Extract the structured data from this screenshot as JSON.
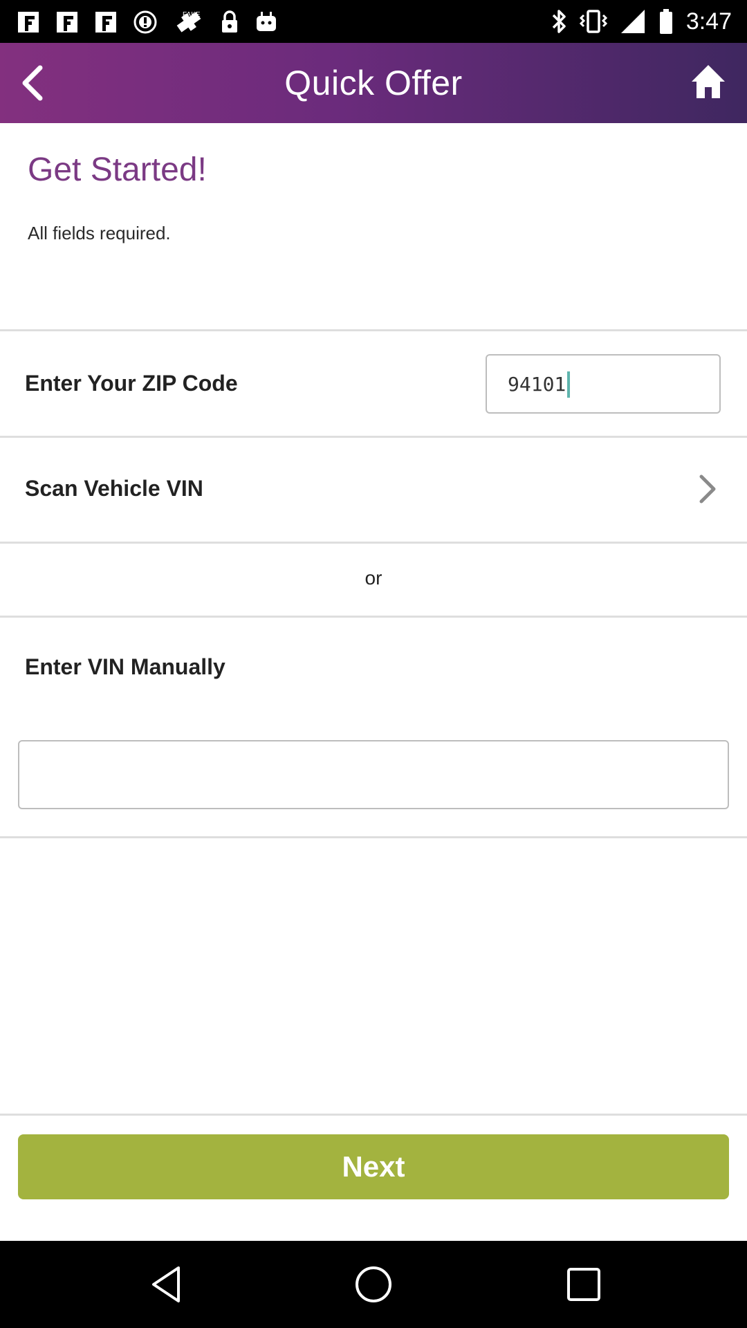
{
  "status_bar": {
    "time": "3:47",
    "left_icons": [
      "app-icon",
      "app-icon",
      "app-icon",
      "clock-alert-icon",
      "satellite-icon",
      "lock-icon",
      "android-icon"
    ],
    "right_icons": [
      "bluetooth-icon",
      "vibrate-icon",
      "signal-icon",
      "battery-icon"
    ]
  },
  "header": {
    "title": "Quick Offer",
    "back_icon": "chevron-left-icon",
    "home_icon": "home-icon",
    "gradient": [
      "#83307f",
      "#3f2760"
    ]
  },
  "intro": {
    "title": "Get Started!",
    "subtitle": "All fields required."
  },
  "zip": {
    "label": "Enter Your ZIP Code",
    "value": "94101"
  },
  "scan": {
    "label": "Scan Vehicle VIN",
    "icon": "chevron-right-icon"
  },
  "separator_text": "or",
  "vin_manual": {
    "label": "Enter VIN Manually",
    "value": "",
    "placeholder": ""
  },
  "next_button": {
    "label": "Next",
    "color": "#a3b33f"
  },
  "nav_bar": {
    "icons": [
      "back-triangle-icon",
      "home-circle-icon",
      "recents-square-icon"
    ]
  },
  "colors": {
    "accent_purple": "#7b3a84",
    "button_green": "#a3b33f",
    "caret": "#5fb5ad"
  }
}
